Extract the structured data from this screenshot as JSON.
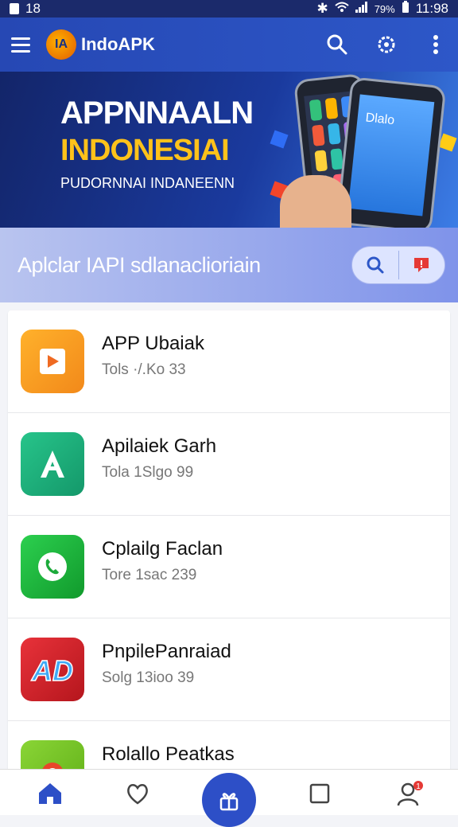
{
  "status_bar": {
    "left_text": "18",
    "battery": "79%",
    "time": "11:98"
  },
  "toolbar": {
    "logo_text": "IA",
    "app_name": "IndoAPK"
  },
  "banner": {
    "title": "APPNNAALN",
    "subtitle": "INDONESIAI",
    "tagline": "PUDORNNAI INDANEENN",
    "phone_label": "Dlalo"
  },
  "search": {
    "label": "Aplclar IAPI sdlanaclioriain"
  },
  "apps": [
    {
      "title": "APP Ubaiak",
      "meta": "Tols ·/.Ko  33",
      "icon": "play-icon",
      "color": "#f59a1a"
    },
    {
      "title": "Apilaiek Garh",
      "meta": "Tola 1Slgo  99",
      "icon": "a-letter-icon",
      "color": "#1fb27a"
    },
    {
      "title": "Cplailg Faclan",
      "meta": "Tore 1sac 239",
      "icon": "phone-chat-icon",
      "color": "#19b33d"
    },
    {
      "title": "PnpilePanraiad",
      "meta": "Solg 13ioo 39",
      "icon": "ad-logo-icon",
      "color": "#d8242b"
    },
    {
      "title": "Rolallo Peatkas",
      "meta": "",
      "icon": "target-icon",
      "color": "#7cc826"
    }
  ],
  "nav": {
    "home": "home-icon",
    "favorites": "heart-icon",
    "center": "gift-icon",
    "apps": "square-icon",
    "profile": "user-icon",
    "profile_badge": "1"
  }
}
